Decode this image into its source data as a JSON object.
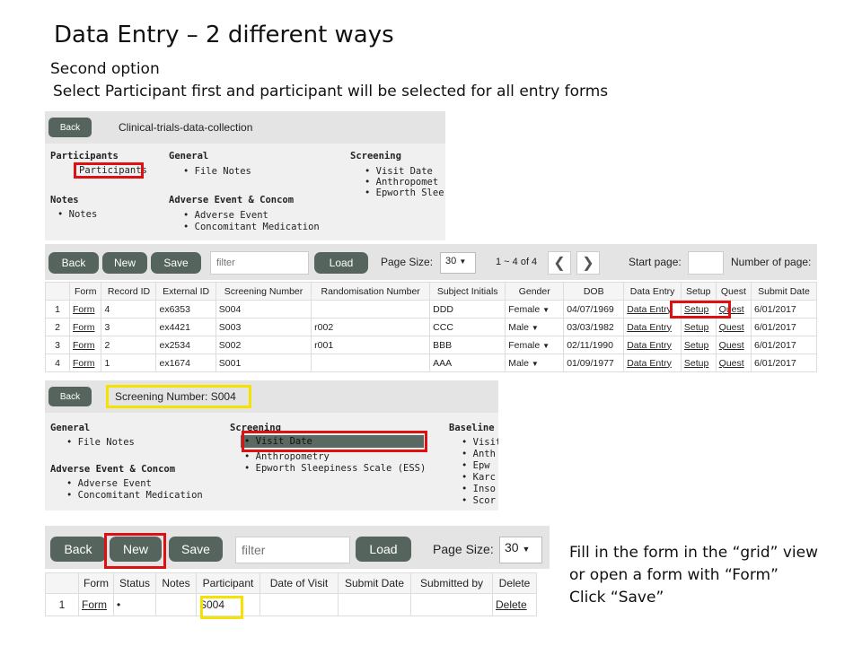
{
  "slide": {
    "title": "Data Entry – 2 different ways",
    "second_option": "Second option",
    "instruction": "Select Participant first and participant will be selected for all entry forms",
    "note_lines": [
      "Fill in the form in the “grid” view",
      "or open a form with “Form”",
      "Click “Save”"
    ]
  },
  "panel1": {
    "back_label": "Back",
    "app_title": "Clinical-trials-data-collection",
    "participants_heading": "Participants",
    "participants_item": "Participants",
    "general_heading": "General",
    "general_items": [
      "File Notes"
    ],
    "screening_heading": "Screening",
    "screening_items": [
      "Visit Date",
      "Anthropomet",
      "Epworth Slee"
    ],
    "notes_heading": "Notes",
    "notes_items": [
      "Notes"
    ],
    "adverse_heading": "Adverse Event & Concom",
    "adverse_items": [
      "Adverse Event",
      "Concomitant Medication"
    ]
  },
  "grid1": {
    "back_label": "Back",
    "new_label": "New",
    "save_label": "Save",
    "filter_placeholder": "filter",
    "load_label": "Load",
    "page_size_label": "Page Size:",
    "page_size_value": "30",
    "range_text": "1 ~ 4 of 4",
    "start_page_label": "Start page:",
    "number_of_page_label": "Number of page:",
    "columns": [
      "",
      "Form",
      "Record ID",
      "External ID",
      "Screening Number",
      "Randomisation Number",
      "Subject Initials",
      "Gender",
      "DOB",
      "Data Entry",
      "Setup",
      "Quest",
      "Submit Date"
    ],
    "rows": [
      {
        "n": "1",
        "form": "Form",
        "record_id": "4",
        "external_id": "ex6353",
        "screening": "S004",
        "random": "",
        "initials": "DDD",
        "gender": "Female",
        "dob": "04/07/1969",
        "data_entry": "Data Entry",
        "setup": "Setup",
        "quest": "Quest",
        "submit": "6/01/2017"
      },
      {
        "n": "2",
        "form": "Form",
        "record_id": "3",
        "external_id": "ex4421",
        "screening": "S003",
        "random": "r002",
        "initials": "CCC",
        "gender": "Male",
        "dob": "03/03/1982",
        "data_entry": "Data Entry",
        "setup": "Setup",
        "quest": "Quest",
        "submit": "6/01/2017"
      },
      {
        "n": "3",
        "form": "Form",
        "record_id": "2",
        "external_id": "ex2534",
        "screening": "S002",
        "random": "r001",
        "initials": "BBB",
        "gender": "Female",
        "dob": "02/11/1990",
        "data_entry": "Data Entry",
        "setup": "Setup",
        "quest": "Quest",
        "submit": "6/01/2017"
      },
      {
        "n": "4",
        "form": "Form",
        "record_id": "1",
        "external_id": "ex1674",
        "screening": "S001",
        "random": "",
        "initials": "AAA",
        "gender": "Male",
        "dob": "01/09/1977",
        "data_entry": "Data Entry",
        "setup": "Setup",
        "quest": "Quest",
        "submit": "6/01/2017"
      }
    ]
  },
  "panel3": {
    "back_label": "Back",
    "screening_number": "Screening Number: S004",
    "general_heading": "General",
    "general_items": [
      "File Notes"
    ],
    "screening_heading": "Screening",
    "screening_items": [
      "Visit Date",
      "Anthropometry",
      "Epworth Sleepiness Scale (ESS)"
    ],
    "baseline_heading": "Baseline",
    "baseline_items": [
      "Visit",
      "Anth",
      "Epw",
      "Karc",
      "Inso",
      "Scor"
    ],
    "adverse_heading": "Adverse Event & Concom",
    "adverse_items": [
      "Adverse Event",
      "Concomitant Medication"
    ]
  },
  "grid2": {
    "back_label": "Back",
    "new_label": "New",
    "save_label": "Save",
    "filter_placeholder": "filter",
    "load_label": "Load",
    "page_size_label": "Page Size:",
    "page_size_value": "30",
    "columns": [
      "",
      "Form",
      "Status",
      "Notes",
      "Participant",
      "Date of Visit",
      "Submit Date",
      "Submitted by",
      "Delete"
    ],
    "row": {
      "n": "1",
      "form": "Form",
      "status": "•",
      "notes": "",
      "participant": "S004",
      "date_of_visit": "",
      "submit_date": "",
      "submitted_by": "",
      "delete": "Delete"
    }
  },
  "colors": {
    "button": "#55655d",
    "highlight_red": "#d11111",
    "highlight_yellow": "#f5e200",
    "selected_item": "#5a6a62"
  }
}
